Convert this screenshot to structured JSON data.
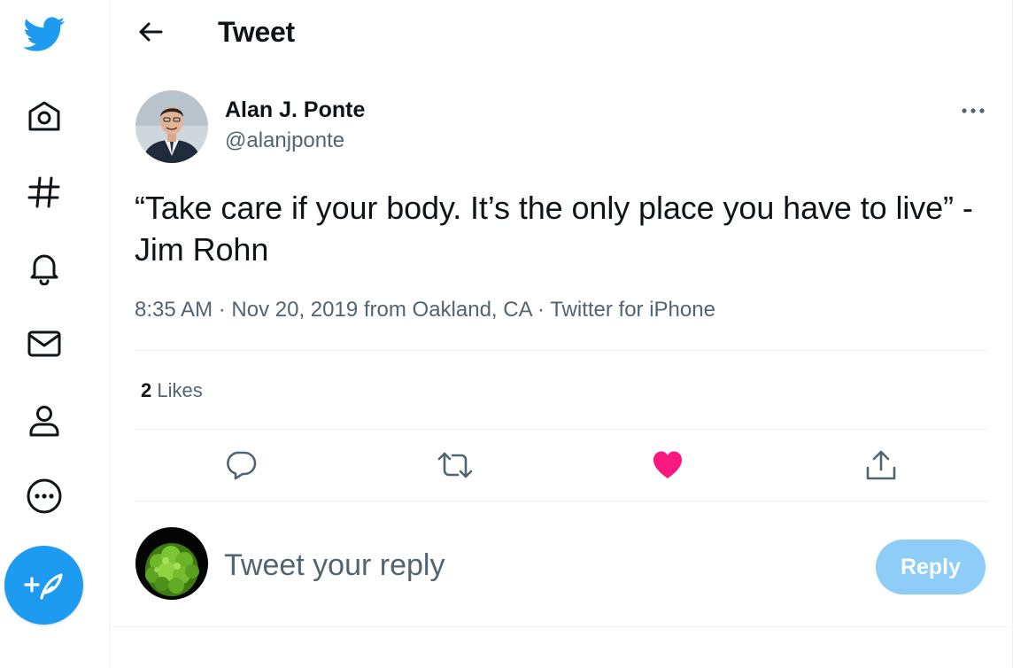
{
  "header": {
    "title": "Tweet"
  },
  "tweet": {
    "author_name": "Alan J. Ponte",
    "author_handle": "@alanjponte",
    "text": "“Take care if your body. It’s the only place you have to live” - Jim Rohn",
    "time": "8:35 AM",
    "date": "Nov 20, 2019",
    "location": "from Oakland, CA",
    "source": "Twitter for iPhone",
    "separator": "·",
    "likes_count": "2",
    "likes_label": "Likes"
  },
  "reply": {
    "placeholder": "Tweet your reply",
    "button_label": "Reply"
  },
  "colors": {
    "accent": "#1d9bf0",
    "like": "#f91880",
    "secondary_text": "#536471",
    "reply_button_disabled": "#8ecdf8"
  },
  "icons": {
    "sidebar": [
      "twitter-logo-icon",
      "home-icon",
      "hashtag-icon",
      "bell-icon",
      "mail-icon",
      "profile-icon",
      "more-circle-icon",
      "compose-icon"
    ],
    "actions": [
      "reply-icon",
      "retweet-icon",
      "like-filled-icon",
      "share-icon"
    ]
  }
}
